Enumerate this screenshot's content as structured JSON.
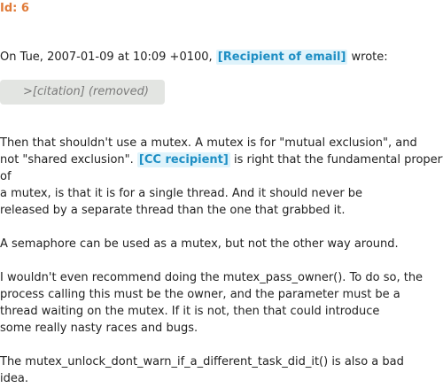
{
  "message": {
    "id_label": "Id: 6",
    "header": {
      "prefix": "On Tue, 2007-01-09 at 10:09 +0100, ",
      "recipient_tag": "[Recipient of email]",
      "suffix": " wrote:"
    },
    "citation": ">[citation] (removed)",
    "paragraphs": {
      "p1": {
        "l1": "Then that shouldn't use a mutex. A mutex is for \"mutual exclusion\", and",
        "l2_pre": "not \"shared exclusion\". ",
        "l2_tag": "[CC recipient]",
        "l2_post": " is right that the fundamental property",
        "l3": "of",
        "l4": "a mutex, is that it is for a single thread. And it should never be",
        "l5": "released by a separate thread than the one that grabbed it."
      },
      "p2": {
        "l1": "A semaphore can be used as a mutex, but not the other way around."
      },
      "p3": {
        "l1": "I wouldn't even recommend doing the mutex_pass_owner(). To do so, the",
        "l2": "process calling this must be the owner, and the parameter must be a",
        "l3": "thread waiting on the mutex. If it is not, then that could introduce",
        "l4": "some really nasty races and bugs."
      },
      "p4": {
        "l1": "The mutex_unlock_dont_warn_if_a_different_task_did_it() is also a bad",
        "l2": "idea."
      }
    }
  },
  "colors": {
    "id_orange": "#e07b39",
    "tag_background": "#dff3fb",
    "tag_text": "#1f8fc4",
    "citation_background": "#e3e5e2",
    "citation_text": "#7a7a7a",
    "body_text": "#222222"
  }
}
